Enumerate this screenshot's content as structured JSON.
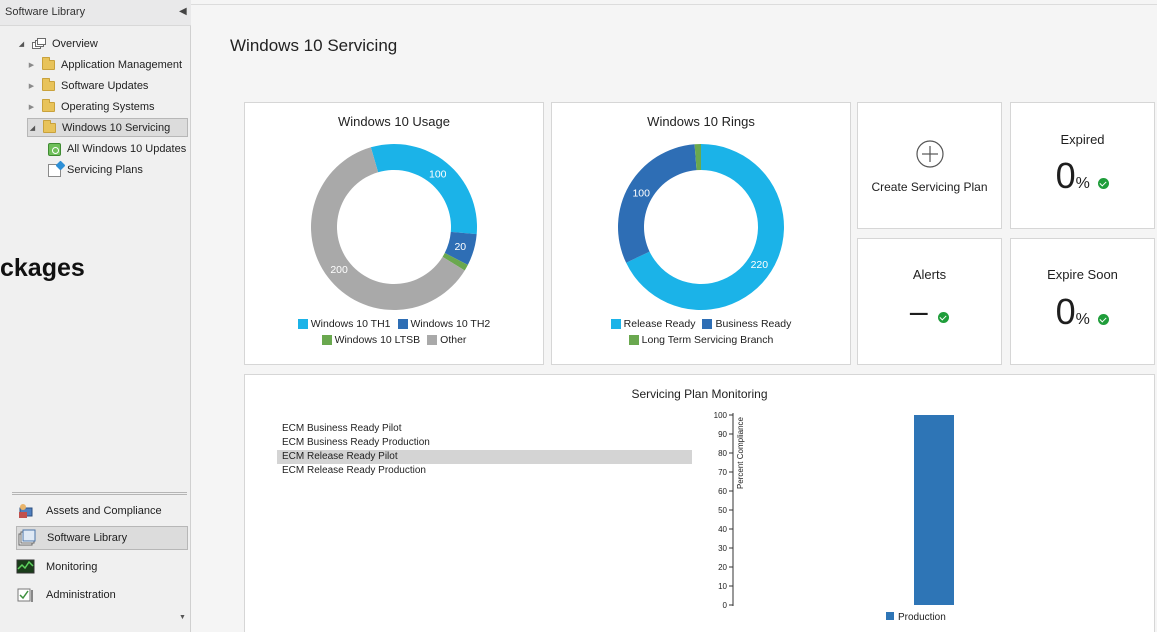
{
  "sidebar": {
    "title": "Software Library",
    "tree": [
      {
        "label": "Overview"
      },
      {
        "label": "Application Management"
      },
      {
        "label": "Software Updates"
      },
      {
        "label": "Operating Systems"
      },
      {
        "label": "Windows 10 Servicing"
      },
      {
        "label": "All Windows 10 Updates"
      },
      {
        "label": "Servicing Plans"
      }
    ],
    "overflow_text": "ckages",
    "workspaces": [
      {
        "label": "Assets and Compliance"
      },
      {
        "label": "Software Library"
      },
      {
        "label": "Monitoring"
      },
      {
        "label": "Administration"
      }
    ]
  },
  "main": {
    "title": "Windows 10 Servicing",
    "usage": {
      "title": "Windows 10 Usage",
      "legend": [
        "Windows 10 TH1",
        "Windows 10 TH2",
        "Windows 10 LTSB",
        "Other"
      ]
    },
    "rings": {
      "title": "Windows 10 Rings",
      "legend": [
        "Release Ready",
        "Business Ready",
        "Long Term Servicing Branch"
      ]
    },
    "create_plan": {
      "label": "Create Servicing Plan"
    },
    "expired": {
      "title": "Expired",
      "value": "0",
      "unit": "%"
    },
    "alerts": {
      "title": "Alerts",
      "value": "–"
    },
    "expire_soon": {
      "title": "Expire Soon",
      "value": "0",
      "unit": "%"
    },
    "monitoring": {
      "title": "Servicing Plan Monitoring",
      "plans": [
        "ECM Business Ready Pilot",
        "ECM Business Ready Production",
        "ECM Release Ready Pilot",
        "ECM Release Ready Production"
      ],
      "selected_plan_index": 2
    }
  },
  "colors": {
    "th1": "#1bb3e8",
    "th2": "#2e6eb5",
    "ltsb": "#6aa84f",
    "other": "#a9a9a9",
    "release_ready": "#1bb3e8",
    "business_ready": "#2e6eb5",
    "ltsb_ring": "#6aa84f",
    "bar": "#2e75b6",
    "check": "#1f9d3a"
  },
  "chart_data": [
    {
      "type": "pie",
      "title": "Windows 10 Usage",
      "categories": [
        "Windows 10 TH1",
        "Windows 10 TH2",
        "Windows 10 LTSB",
        "Other"
      ],
      "values": [
        100,
        20,
        4,
        200
      ],
      "labels": [
        "100",
        "20",
        "",
        "200"
      ]
    },
    {
      "type": "pie",
      "title": "Windows 10 Rings",
      "categories": [
        "Release Ready",
        "Business Ready",
        "Long Term Servicing Branch"
      ],
      "values": [
        220,
        100,
        4
      ],
      "labels": [
        "220",
        "100",
        ""
      ]
    },
    {
      "type": "bar",
      "title": "",
      "categories": [
        "Production"
      ],
      "series": [
        {
          "name": "Production",
          "values": [
            100
          ]
        }
      ],
      "ylabel": "Percent Compliance",
      "ylim": [
        0,
        100
      ],
      "yticks": [
        "0",
        "10",
        "20",
        "30",
        "40",
        "50",
        "60",
        "70",
        "80",
        "90",
        "100"
      ]
    }
  ]
}
